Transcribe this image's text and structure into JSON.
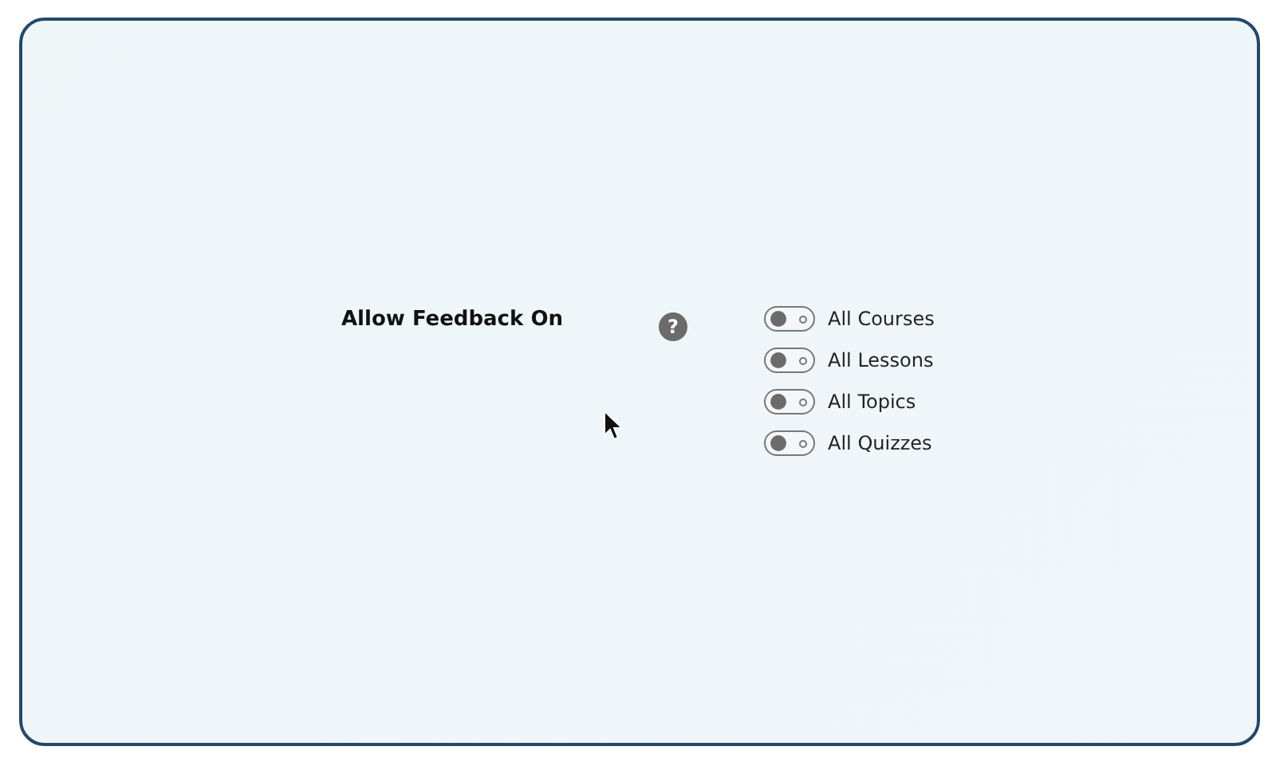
{
  "setting": {
    "label": "Allow Feedback On",
    "help": "?",
    "options": [
      {
        "label": "All Courses",
        "on": false
      },
      {
        "label": "All Lessons",
        "on": false
      },
      {
        "label": "All Topics",
        "on": false
      },
      {
        "label": "All Quizzes",
        "on": false
      }
    ]
  }
}
